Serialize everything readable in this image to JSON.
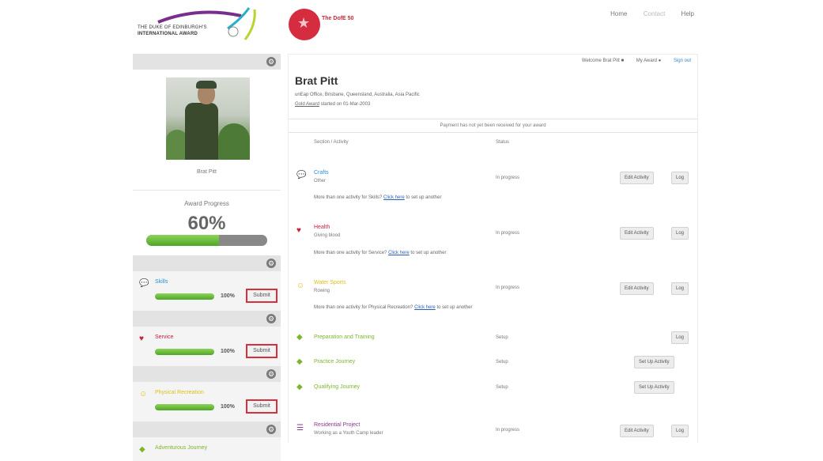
{
  "header": {
    "dofe_logo_line1": "THE DUKE OF EDINBURGH'S",
    "dofe_logo_line2": "INTERNATIONAL AWARD",
    "anniv_logo_line1": "The DofE 50",
    "anniv_logo_line2": "",
    "nav": [
      "Home",
      "Contact",
      "Help"
    ]
  },
  "sidebar": {
    "profile_name": "Brat Pitt",
    "progress_label": "Award Progress",
    "progress_value": "60%",
    "progress_fraction": 0.6,
    "sections": [
      {
        "title": "Skills",
        "percent_label": "100%",
        "fraction": 1.0,
        "submit_label": "Submit",
        "color": "#2c8fd0",
        "icon": "speech-bubble-icon"
      },
      {
        "title": "Service",
        "percent_label": "100%",
        "fraction": 1.0,
        "submit_label": "Submit",
        "color": "#c4203a",
        "icon": "hands-icon"
      },
      {
        "title": "Physical Recreation",
        "percent_label": "100%",
        "fraction": 1.0,
        "submit_label": "Submit",
        "color": "#d9c21a",
        "icon": "runner-icon"
      }
    ],
    "last_section_title": "Adventurous Journey"
  },
  "main": {
    "welcome": "Welcome Brat Pitt",
    "my_award": "My Award",
    "sign_out": "Sign out",
    "participant_name": "Brat Pitt",
    "meta_line1": "unEap Office, Brisbane, Queensland, Australia, Asia Pacific",
    "meta_link": "Gold Award",
    "meta_line2_rest": "started on 01-Mar-2003",
    "payment_notice": "Payment has not yet been received for your award",
    "col_section": "Section / Activity",
    "col_status": "Status",
    "activities": [
      {
        "section": "Skills",
        "title": "Crafts",
        "sub": "Other",
        "status": "In progress",
        "color": "#2c8fd0",
        "icon": "speech-bubble-icon",
        "buttons": [
          "Edit Activity",
          "Log"
        ],
        "more_prefix": "More than one activity for Skills?",
        "more_link": "Click here",
        "more_suffix": "to set up another"
      },
      {
        "section": "Service",
        "title": "Health",
        "sub": "Giving blood",
        "status": "In progress",
        "color": "#c4203a",
        "icon": "hands-icon",
        "buttons": [
          "Edit Activity",
          "Log"
        ],
        "more_prefix": "More than one activity for Service?",
        "more_link": "Click here",
        "more_suffix": "to set up another"
      },
      {
        "section": "Physical Recreation",
        "title": "Water Sports",
        "sub": "Rowing",
        "status": "In progress",
        "color": "#d9c21a",
        "icon": "runner-icon",
        "buttons": [
          "Edit Activity",
          "Log"
        ],
        "more_prefix": "More than one activity for Physical Recreation?",
        "more_link": "Click here",
        "more_suffix": "to set up another"
      }
    ],
    "journeys": [
      {
        "title": "Preparation and Training",
        "status": "Setup",
        "button": "Log"
      },
      {
        "title": "Practice Journey",
        "status": "Setup",
        "button": "Set Up Activity"
      },
      {
        "title": "Qualifying Journey",
        "status": "Setup",
        "button": "Set Up Activity"
      }
    ],
    "residential": {
      "title": "Residential Project",
      "sub": "Working as a Youth Camp leader",
      "status": "In progress",
      "buttons": [
        "Edit Activity",
        "Log"
      ]
    }
  },
  "colors": {
    "journey_green": "#7fb52e",
    "residential_purple": "#8a3b8f",
    "submit_highlight": "#d6303f"
  }
}
